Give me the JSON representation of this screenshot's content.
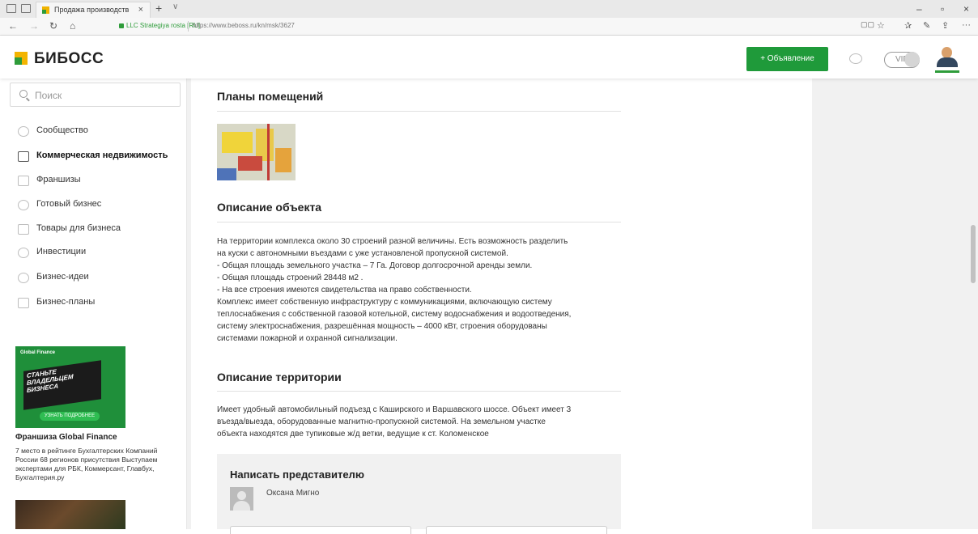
{
  "browser": {
    "tab_title": "Продажа производств",
    "tab_close": "×",
    "tab_new": "+",
    "tab_dropdown": "∨",
    "site_identity": "LLC Strategiya rosta [RU]",
    "url": "https://www.beboss.ru/kn/msk/3627",
    "window_minimize": "–",
    "window_maximize": "▫",
    "window_close": "×",
    "back": "←",
    "forward": "→",
    "reload": "↻",
    "home": "⌂",
    "tool_reading": "▢▢",
    "tool_favorite": "☆",
    "tool_favorites": "✰",
    "tool_notes": "✎",
    "tool_share": "⇪",
    "tool_more": "···"
  },
  "header": {
    "logo_text": "БИБОСС",
    "add_button": "+ Объявление",
    "vip_label": "VIP"
  },
  "sidebar": {
    "search_placeholder": "Поиск",
    "items": [
      {
        "label": "Сообщество",
        "icon": "people-icon",
        "active": false
      },
      {
        "label": "Коммерческая недвижимость",
        "icon": "building-icon",
        "active": true
      },
      {
        "label": "Франшизы",
        "icon": "briefcase-icon",
        "active": false
      },
      {
        "label": "Готовый бизнес",
        "icon": "business-icon",
        "active": false
      },
      {
        "label": "Товары для бизнеса",
        "icon": "box-icon",
        "active": false
      },
      {
        "label": "Инвестиции",
        "icon": "coin-icon",
        "active": false
      },
      {
        "label": "Бизнес-идеи",
        "icon": "lightbulb-icon",
        "active": false
      },
      {
        "label": "Бизнес-планы",
        "icon": "document-icon",
        "active": false
      }
    ]
  },
  "ad": {
    "banner_brand": "Global Finance",
    "banner_headline": "СТАНЬТЕ\nВЛАДЕЛЬЦЕМ\nБИЗНЕСА",
    "banner_cta": "УЗНАТЬ ПОДРОБНЕЕ",
    "title": "Франшиза Global Finance",
    "description": "7 место в рейтинге Бухгалтерских Компаний России 68 регионов присутствия Выступаем экспертами для РБК, Коммерсант, Главбух, Бухгалтерия.ру"
  },
  "main": {
    "plans_title": "Планы помещений",
    "description_title": "Описание объекта",
    "description_lines": [
      "На территории комплекса около 30 строений разной величины. Есть возможность разделить",
      "на куски с автономными въездами с уже установленой пропускной системой.",
      "- Общая площадь земельного участка – 7 Га. Договор долгосрочной аренды земли.",
      "- Общая площадь строений 28448 м2 .",
      "- На все строения имеются свидетельства на право собственности.",
      "Комплекс имеет собственную инфраструктуру с коммуникациями, включающую систему",
      "теплоснабжения с собственной газовой котельной, систему водоснабжения и водоотведения,",
      "систему электроснабжения, разрешённая мощность – 4000 кВт, строения оборудованы",
      "системами пожарной и охранной сигнализации."
    ],
    "territory_title": "Описание территории",
    "territory_lines": [
      "Имеет удобный автомобильный подъезд с Каширского и Варшавского шоссе. Объект имеет 3",
      "въезда/выезда, оборудованные магнитно-пропускной системой. На земельном участке",
      "объекта находятся две тупиковые ж/д ветки, ведущие к ст. Коломенское"
    ],
    "contact_title": "Написать представителю",
    "contact_name": "Оксана Мигно"
  },
  "colors": {
    "brand_green": "#1f9a3a",
    "brand_yellow": "#f3b400"
  }
}
